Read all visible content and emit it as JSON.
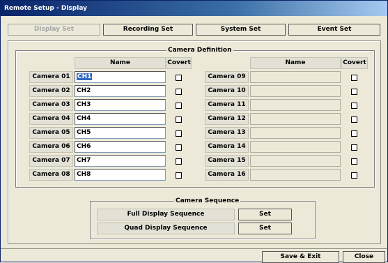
{
  "window": {
    "title": "Remote Setup - Display"
  },
  "tabs": [
    {
      "label": "Display Set",
      "disabled": true
    },
    {
      "label": "Recording Set",
      "disabled": false
    },
    {
      "label": "System Set",
      "disabled": false
    },
    {
      "label": "Event Set",
      "disabled": false
    }
  ],
  "camera_definition": {
    "title": "Camera Definition",
    "name_header": "Name",
    "covert_header": "Covert",
    "left": [
      {
        "label": "Camera 01",
        "name": "CH1",
        "covert": false
      },
      {
        "label": "Camera 02",
        "name": "CH2",
        "covert": false
      },
      {
        "label": "Camera 03",
        "name": "CH3",
        "covert": false
      },
      {
        "label": "Camera 04",
        "name": "CH4",
        "covert": false
      },
      {
        "label": "Camera 05",
        "name": "CH5",
        "covert": false
      },
      {
        "label": "Camera 06",
        "name": "CH6",
        "covert": false
      },
      {
        "label": "Camera 07",
        "name": "CH7",
        "covert": false
      },
      {
        "label": "Camera 08",
        "name": "CH8",
        "covert": false
      }
    ],
    "right": [
      {
        "label": "Camera 09",
        "name": "",
        "covert": false
      },
      {
        "label": "Camera 10",
        "name": "",
        "covert": false
      },
      {
        "label": "Camera 11",
        "name": "",
        "covert": false
      },
      {
        "label": "Camera 12",
        "name": "",
        "covert": false
      },
      {
        "label": "Camera 13",
        "name": "",
        "covert": false
      },
      {
        "label": "Camera 14",
        "name": "",
        "covert": false
      },
      {
        "label": "Camera 15",
        "name": "",
        "covert": false
      },
      {
        "label": "Camera 16",
        "name": "",
        "covert": false
      }
    ]
  },
  "camera_sequence": {
    "title": "Camera Sequence",
    "rows": [
      {
        "label": "Full Display Sequence",
        "button": "Set"
      },
      {
        "label": "Quad Display Sequence",
        "button": "Set"
      }
    ]
  },
  "footer": {
    "save_exit": "Save & Exit",
    "close": "Close"
  }
}
